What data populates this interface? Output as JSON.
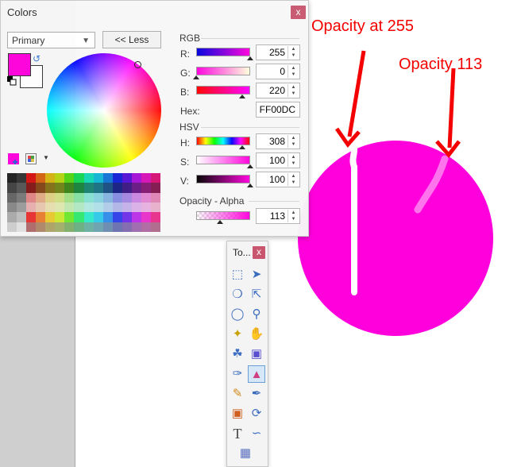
{
  "colors_window": {
    "title": "Colors",
    "close_label": "x",
    "primary_select": "Primary",
    "less_button": "<< Less",
    "rgb_label": "RGB",
    "r_label": "R:",
    "r_value": "255",
    "g_label": "G:",
    "g_value": "0",
    "b_label": "B:",
    "b_value": "220",
    "hex_label": "Hex:",
    "hex_value": "FF00DC",
    "hsv_label": "HSV",
    "h_label": "H:",
    "h_value": "308",
    "s_label": "S:",
    "s_value": "100",
    "v_label": "V:",
    "v_value": "100",
    "alpha_label": "Opacity - Alpha",
    "alpha_value": "113",
    "primary_color": "#ff00dc"
  },
  "tools_window": {
    "title": "To...",
    "close_label": "x",
    "tools": [
      "rectangle-select-icon",
      "move-selection-icon",
      "lasso-select-icon",
      "move-selected-icon",
      "ellipse-select-icon",
      "zoom-icon",
      "magic-wand-icon",
      "pan-icon",
      "paint-bucket-icon",
      "gradient-icon",
      "paintbrush-icon",
      "eraser-icon",
      "pencil-icon",
      "color-picker-icon",
      "clone-stamp-icon",
      "recolor-icon",
      "text-icon",
      "line-curve-icon",
      "shapes-icon"
    ],
    "active_tool": "eraser-icon"
  },
  "canvas": {
    "annotation_left": "Opacity at 255",
    "annotation_right": "Opacity 113",
    "circle_color": "#ff00dc",
    "annotation_color": "#f40000"
  }
}
